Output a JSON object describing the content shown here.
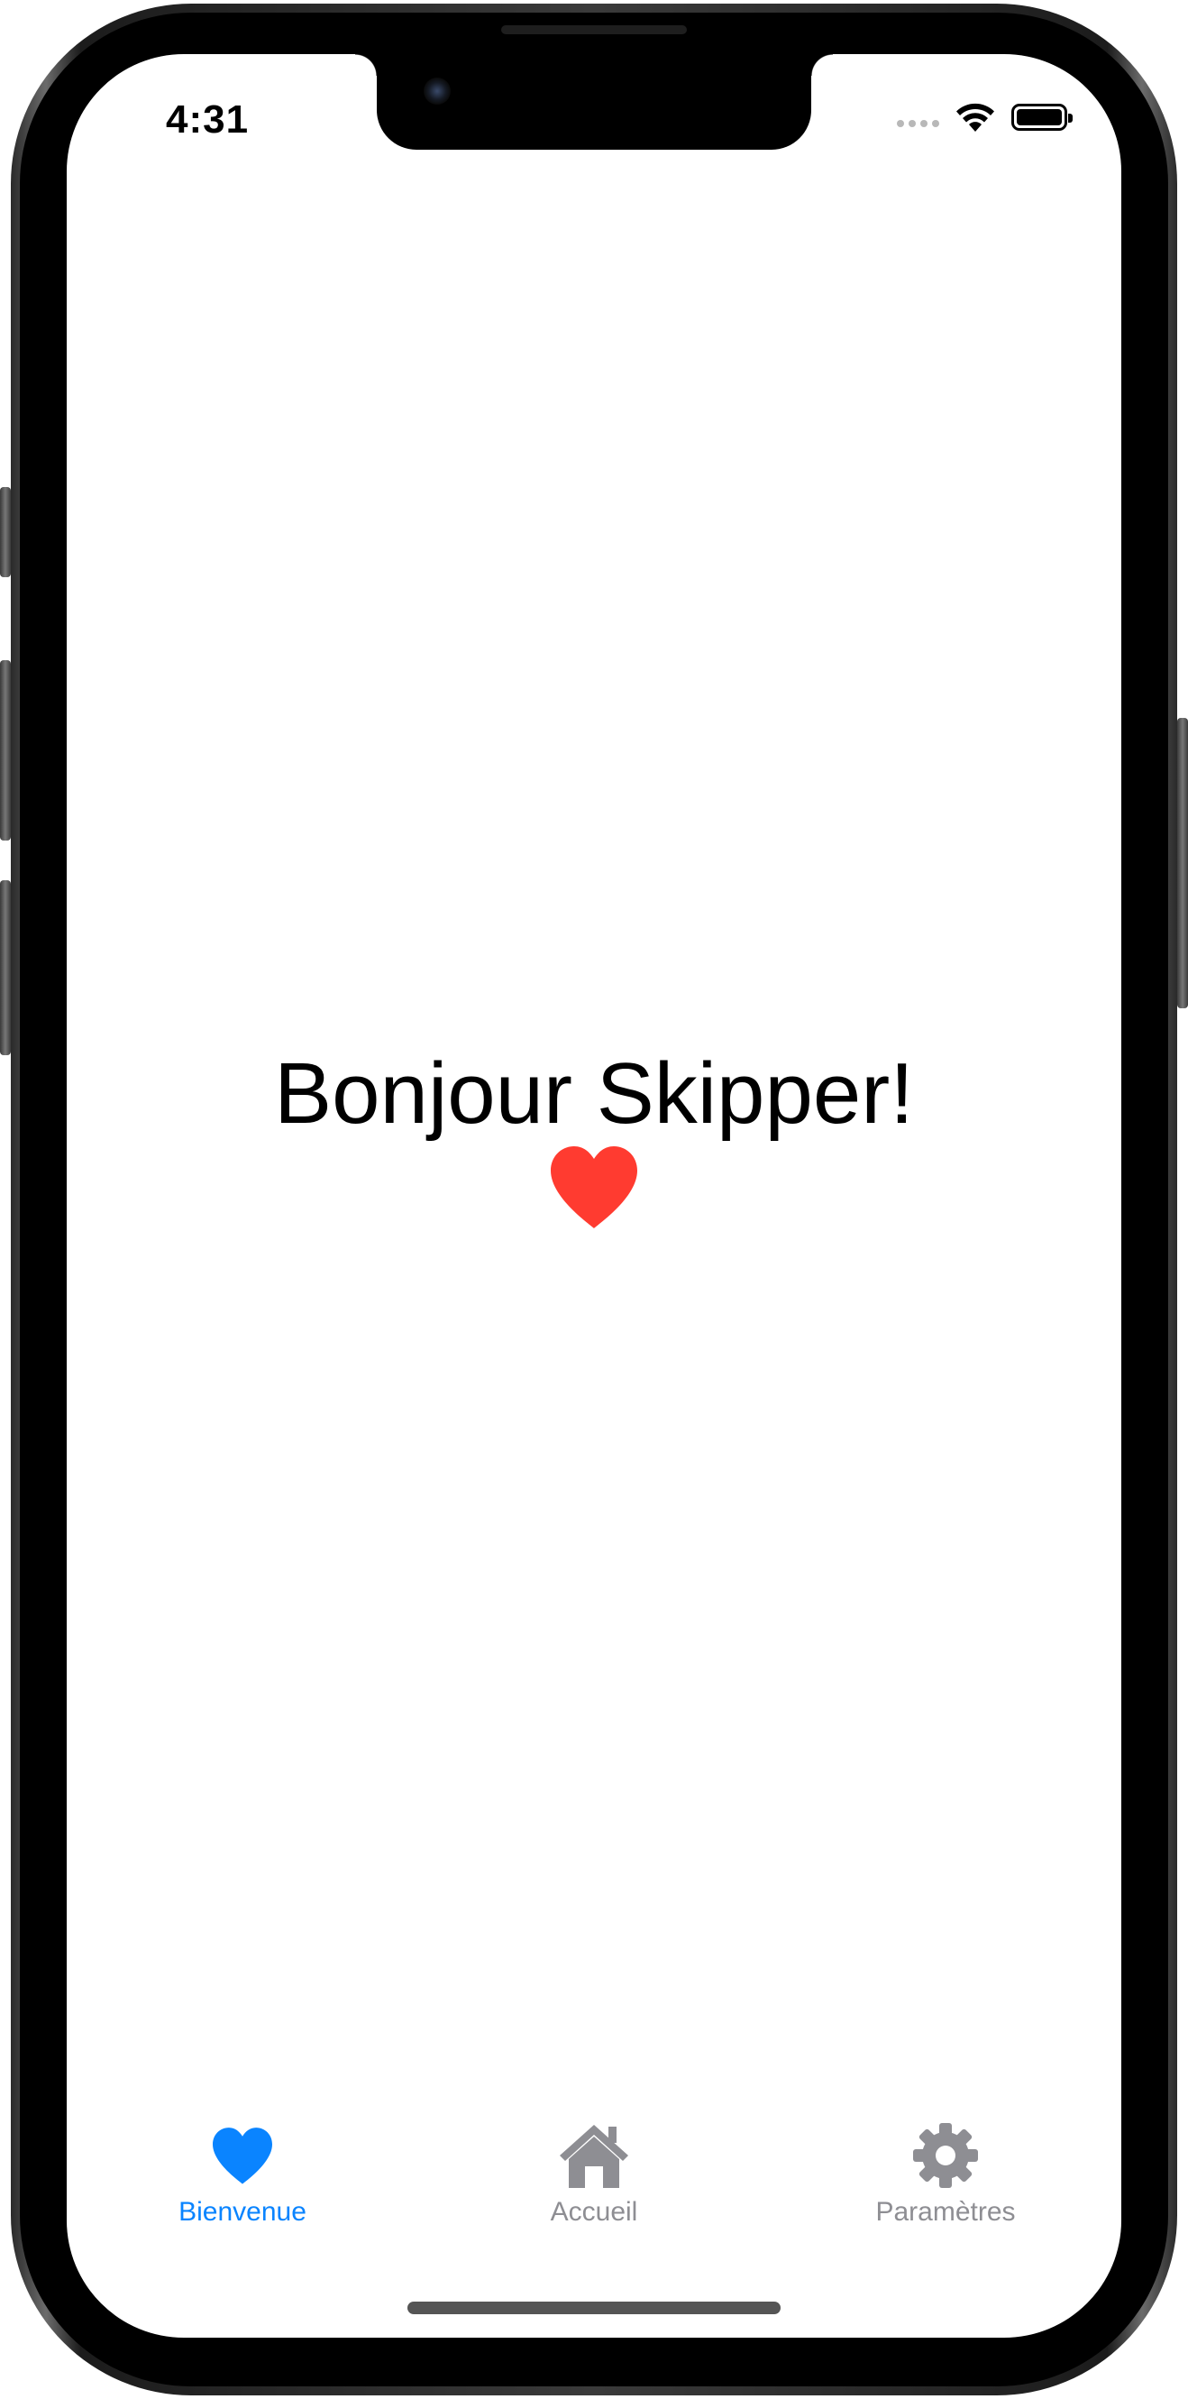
{
  "status_bar": {
    "time": "4:31"
  },
  "main": {
    "greeting": "Bonjour Skipper!",
    "greeting_icon": "heart-icon"
  },
  "tab_bar": {
    "tabs": [
      {
        "label": "Bienvenue",
        "icon": "heart-icon",
        "selected": true
      },
      {
        "label": "Accueil",
        "icon": "house-icon",
        "selected": false
      },
      {
        "label": "Paramètres",
        "icon": "gear-icon",
        "selected": false
      }
    ]
  },
  "colors": {
    "accent": "#0a84ff",
    "heart": "#ff3b30",
    "inactive": "#8e8e93"
  }
}
